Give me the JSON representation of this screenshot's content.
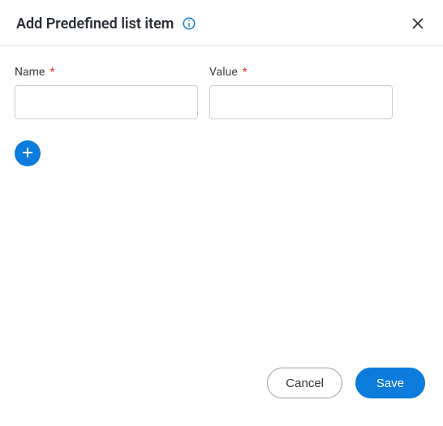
{
  "header": {
    "title": "Add Predefined list item"
  },
  "fields": {
    "name": {
      "label": "Name",
      "required_marker": "*",
      "value": ""
    },
    "value": {
      "label": "Value",
      "required_marker": "*",
      "value": ""
    }
  },
  "footer": {
    "cancel_label": "Cancel",
    "save_label": "Save"
  },
  "colors": {
    "primary": "#0b7bdc",
    "required": "#e33535"
  }
}
